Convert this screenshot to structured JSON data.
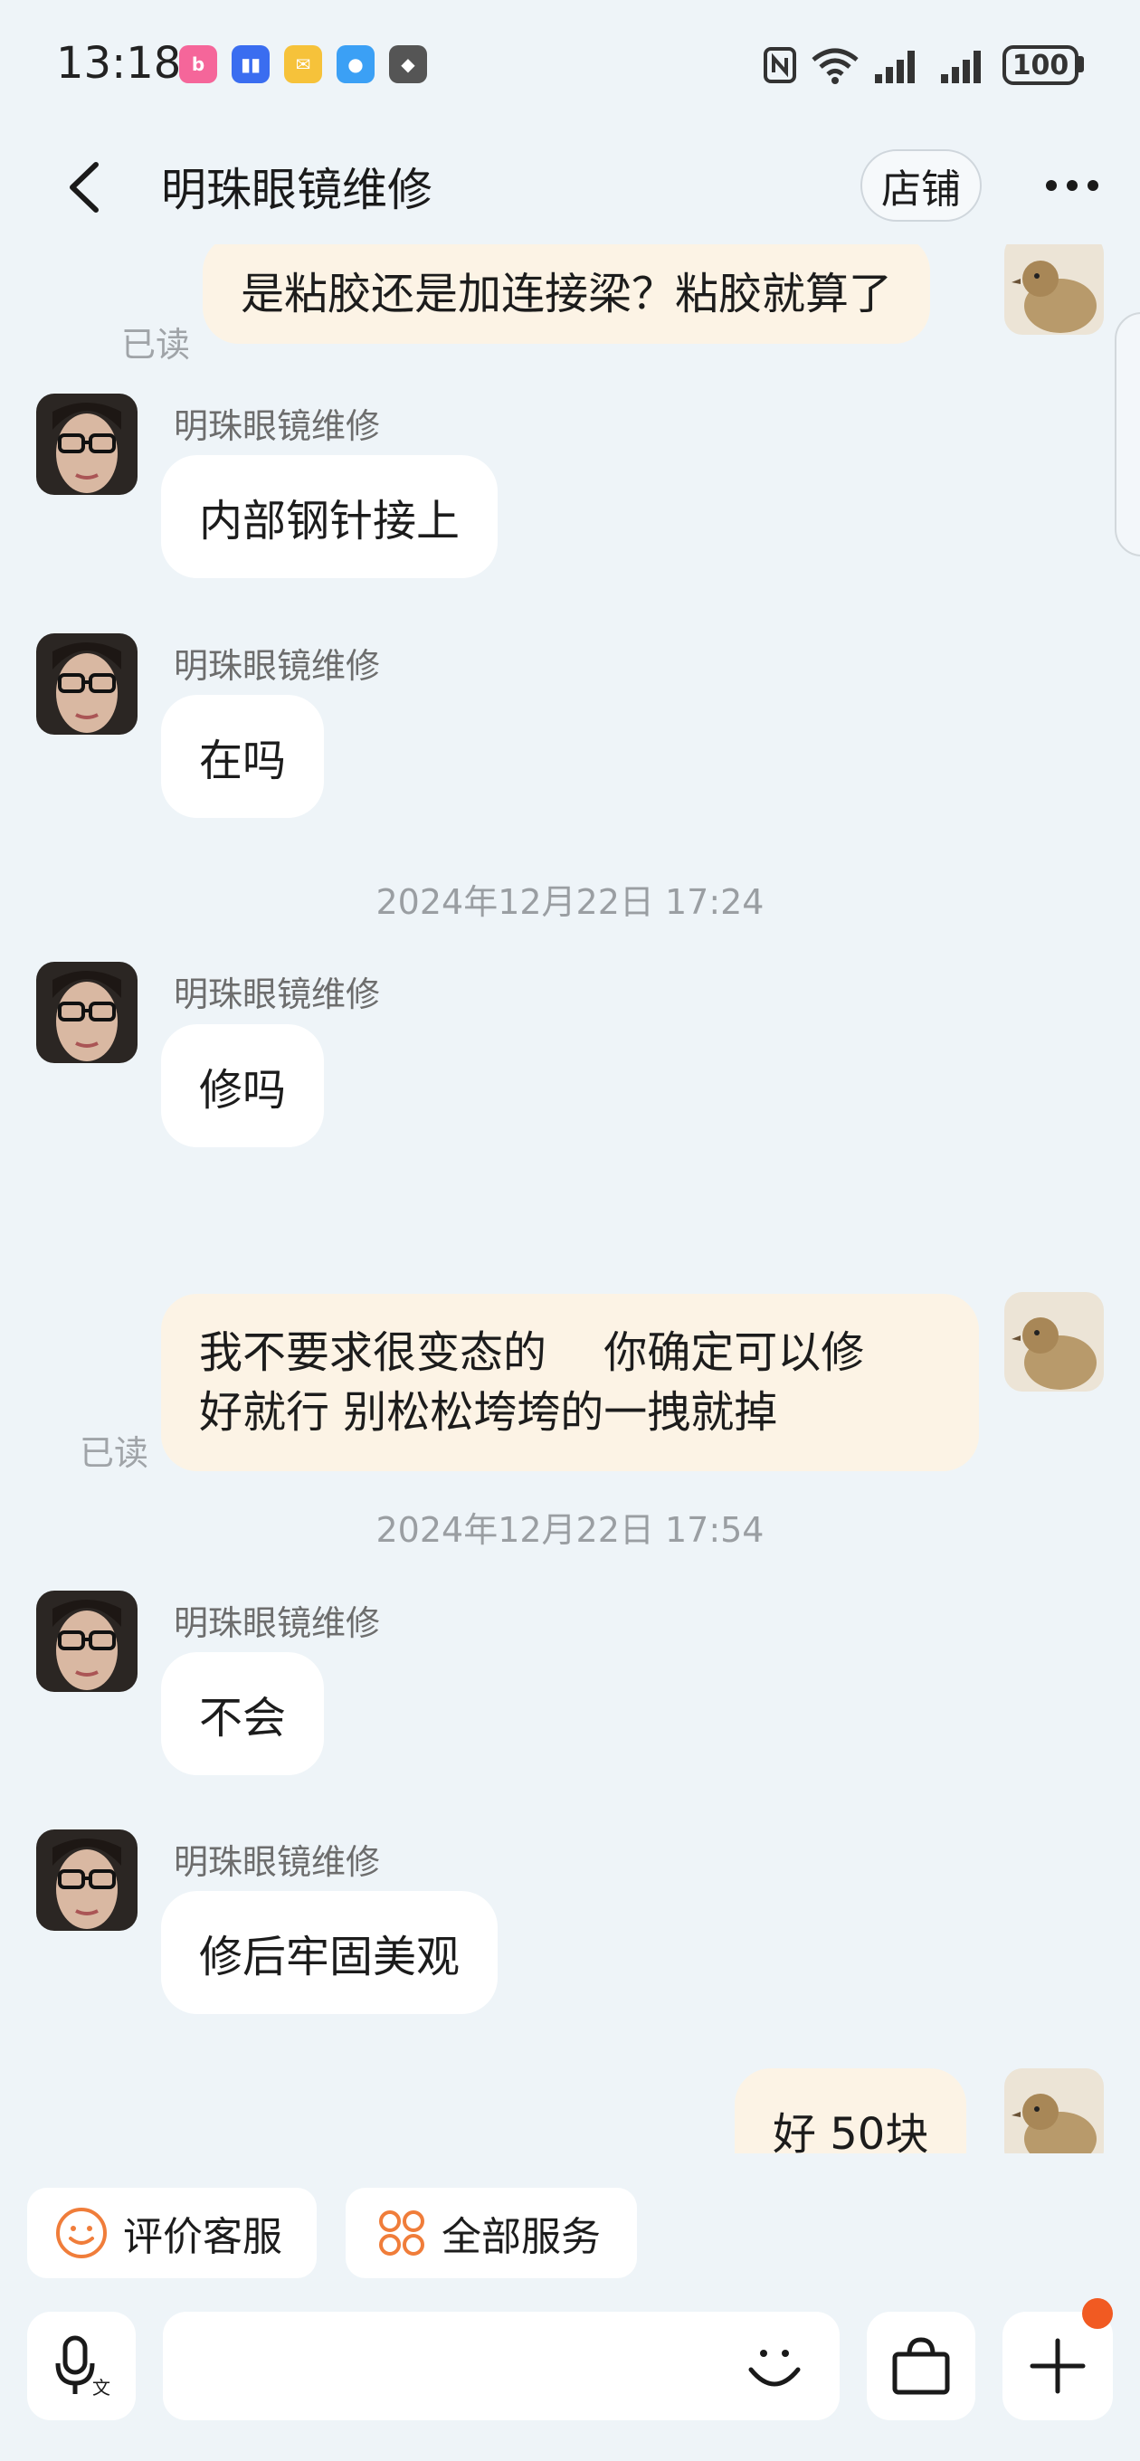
{
  "status_bar": {
    "time": "13:18",
    "battery": "100",
    "app_icons": [
      "bilibili-icon",
      "voice-app-icon",
      "mail-app-icon",
      "message-app-icon",
      "game-app-icon"
    ]
  },
  "header": {
    "title": "明珠眼镜维修",
    "shop_button": "店铺"
  },
  "messages": [
    {
      "side": "right",
      "text": "是粘胶还是加连接梁？粘胶就算了",
      "read": "已读"
    },
    {
      "side": "left",
      "sender": "明珠眼镜维修",
      "text": "内部钢针接上"
    },
    {
      "side": "left",
      "sender": "明珠眼镜维修",
      "text": "在吗"
    },
    {
      "type": "timestamp",
      "text": "2024年12月22日 17:24"
    },
    {
      "side": "left",
      "sender": "明珠眼镜维修",
      "text": "修吗"
    },
    {
      "side": "right",
      "lines": [
        "我不要求很变态的　 你确定可以修",
        "好就行  别松松垮垮的一拽就掉"
      ],
      "read": "已读"
    },
    {
      "type": "timestamp",
      "text": "2024年12月22日 17:54"
    },
    {
      "side": "left",
      "sender": "明珠眼镜维修",
      "text": "不会"
    },
    {
      "side": "left",
      "sender": "明珠眼镜维修",
      "text": "修后牢固美观"
    },
    {
      "side": "right",
      "text": "好  50块"
    }
  ],
  "quick_actions": {
    "rate": "评价客服",
    "all_services": "全部服务"
  },
  "colors": {
    "background": "#eef4f8",
    "bubble_mine": "#fcf3e5",
    "bubble_theirs": "#ffffff",
    "accent": "#f07d3a",
    "badge": "#f15a22"
  }
}
